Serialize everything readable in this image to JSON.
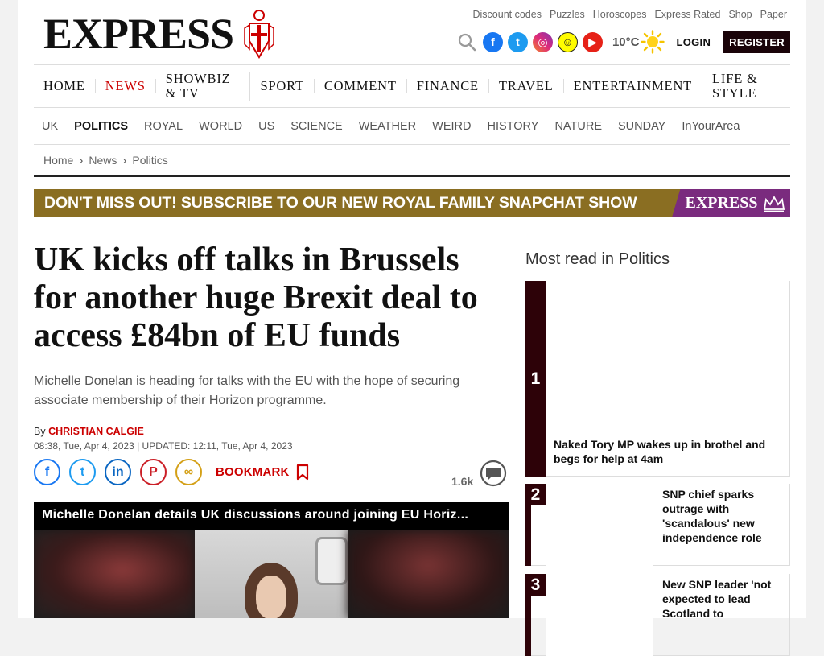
{
  "brand": {
    "logo_text": "EXPRESS"
  },
  "utility_links": [
    "Discount codes",
    "Puzzles",
    "Horoscopes",
    "Express Rated",
    "Shop",
    "Paper"
  ],
  "social": [
    {
      "name": "facebook-icon",
      "glyph": "f"
    },
    {
      "name": "twitter-icon",
      "glyph": "t"
    },
    {
      "name": "instagram-icon",
      "glyph": "◎"
    },
    {
      "name": "snapchat-icon",
      "glyph": "☺"
    },
    {
      "name": "youtube-icon",
      "glyph": "▶"
    }
  ],
  "weather": {
    "temp": "10°C",
    "icon": "sun-icon"
  },
  "account": {
    "login": "LOGIN",
    "register": "REGISTER"
  },
  "nav_primary": [
    {
      "label": "HOME",
      "active": false
    },
    {
      "label": "NEWS",
      "active": true
    },
    {
      "label": "SHOWBIZ & TV",
      "active": false
    },
    {
      "label": "SPORT",
      "active": false
    },
    {
      "label": "COMMENT",
      "active": false
    },
    {
      "label": "FINANCE",
      "active": false
    },
    {
      "label": "TRAVEL",
      "active": false
    },
    {
      "label": "ENTERTAINMENT",
      "active": false
    },
    {
      "label": "LIFE & STYLE",
      "active": false
    }
  ],
  "nav_secondary": [
    {
      "label": "UK",
      "active": false
    },
    {
      "label": "POLITICS",
      "active": true
    },
    {
      "label": "ROYAL",
      "active": false
    },
    {
      "label": "WORLD",
      "active": false
    },
    {
      "label": "US",
      "active": false
    },
    {
      "label": "SCIENCE",
      "active": false
    },
    {
      "label": "WEATHER",
      "active": false
    },
    {
      "label": "WEIRD",
      "active": false
    },
    {
      "label": "HISTORY",
      "active": false
    },
    {
      "label": "NATURE",
      "active": false
    },
    {
      "label": "SUNDAY",
      "active": false
    },
    {
      "label": "InYourArea",
      "active": false
    }
  ],
  "breadcrumb": [
    "Home",
    "News",
    "Politics"
  ],
  "banner": {
    "text": "DON'T MISS OUT! SUBSCRIBE TO OUR NEW ROYAL FAMILY SNAPCHAT SHOW",
    "badge": "EXPRESS"
  },
  "article": {
    "headline": "UK kicks off talks in Brussels for another huge Brexit deal to access £84bn of EU funds",
    "standfirst": "Michelle Donelan is heading for talks with the EU with the hope of securing associate membership of their Horizon programme.",
    "by_prefix": "By",
    "author": "CHRISTIAN CALGIE",
    "dateline": "08:38, Tue, Apr 4, 2023 | UPDATED: 12:11, Tue, Apr 4, 2023",
    "bookmark_label": "BOOKMARK",
    "comment_count": "1.6k",
    "video_title": "Michelle Donelan details UK discussions around joining EU Horiz..."
  },
  "share": [
    {
      "name": "share-facebook-icon",
      "glyph": "f",
      "cls": "fb"
    },
    {
      "name": "share-twitter-icon",
      "glyph": "t",
      "cls": "tw"
    },
    {
      "name": "share-linkedin-icon",
      "glyph": "in",
      "cls": "li"
    },
    {
      "name": "share-pinterest-icon",
      "glyph": "P",
      "cls": "pi"
    },
    {
      "name": "share-link-icon",
      "glyph": "∞",
      "cls": "ln"
    }
  ],
  "most_read": {
    "title": "Most read in Politics",
    "items": [
      {
        "num": "1",
        "text": "Naked Tory MP wakes up in brothel and begs for help at 4am"
      },
      {
        "num": "2",
        "text": "SNP chief sparks outrage with 'scandalous' new independence role"
      },
      {
        "num": "3",
        "text": "New SNP leader 'not expected to lead Scotland to"
      }
    ]
  },
  "colors": {
    "accent_red": "#cc0000",
    "dark_maroon": "#2d0208",
    "banner_gold": "#8a6e22",
    "banner_purple": "#7a2b7e"
  }
}
